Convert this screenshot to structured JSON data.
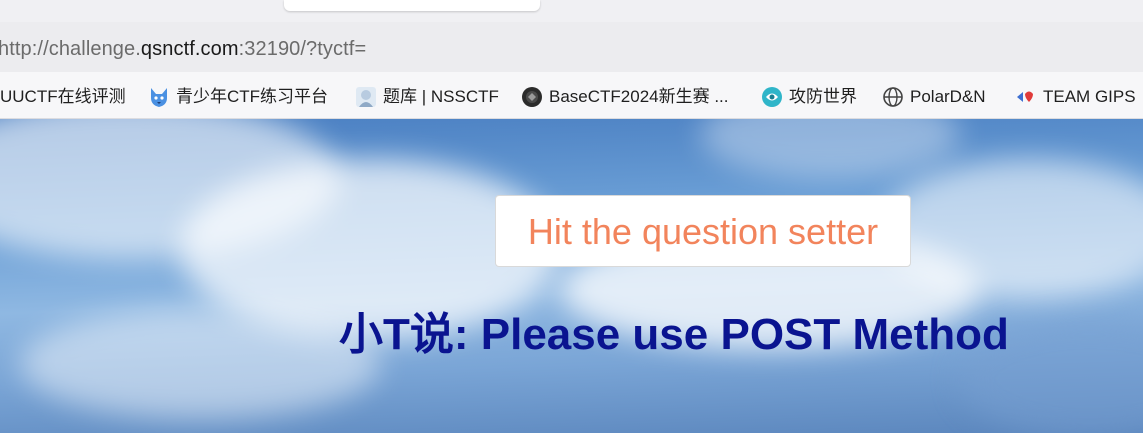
{
  "browser": {
    "address_bar": {
      "prefix": "http://challenge.",
      "host": "qsnctf.com",
      "suffix": ":32190/?tyctf="
    },
    "bookmarks": [
      {
        "label": "UUCTF在线评测",
        "icon": "none"
      },
      {
        "label": "青少年CTF练习平台",
        "icon": "wolf-icon"
      },
      {
        "label": "题库 | NSSCTF",
        "icon": "nssctf-avatar-icon"
      },
      {
        "label": "BaseCTF2024新生赛 ...",
        "icon": "basectf-logo-icon"
      },
      {
        "label": "攻防世界",
        "icon": "adworld-logo-icon"
      },
      {
        "label": "PolarD&N",
        "icon": "globe-icon"
      },
      {
        "label": "TEAM GIPS",
        "icon": "team-gips-icon"
      }
    ]
  },
  "page": {
    "button_label": "Hit the question setter",
    "headline": "小T说: Please use POST Method",
    "colors": {
      "button_text": "#f2845c",
      "headline_text": "#0a1490",
      "sky": "#6b9fd6"
    }
  }
}
